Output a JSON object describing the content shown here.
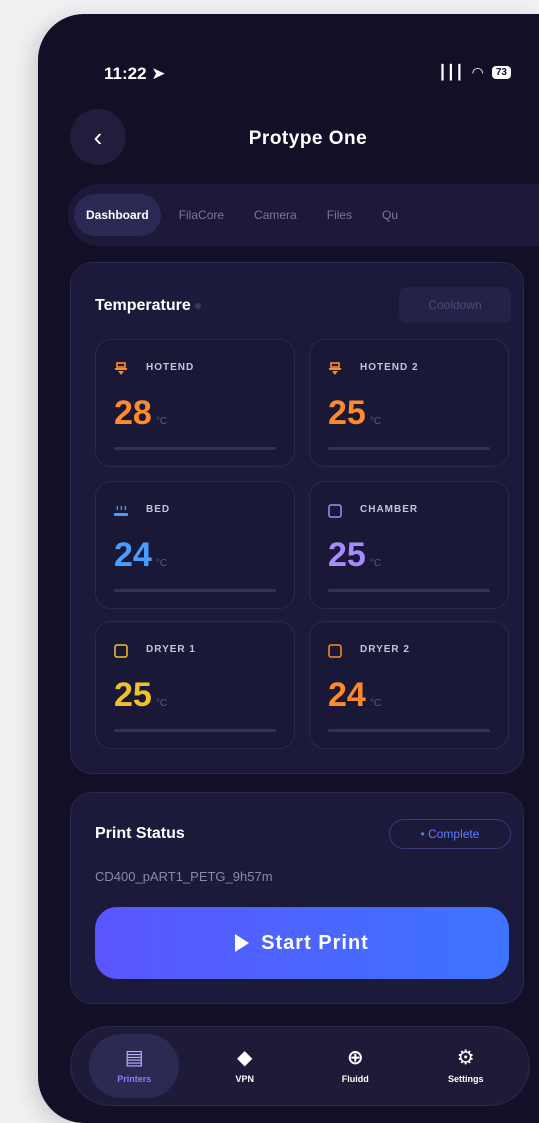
{
  "status_bar": {
    "time": "11:22",
    "signal": "│││",
    "battery": "73"
  },
  "header": {
    "title": "Protype One"
  },
  "tabs": [
    {
      "label": "Dashboard"
    },
    {
      "label": "FilaCore"
    },
    {
      "label": "Camera"
    },
    {
      "label": "Files"
    },
    {
      "label": "Qu"
    }
  ],
  "temperature": {
    "title": "Temperature",
    "cooldown_label": "Cooldown",
    "unit": "°C",
    "tiles": [
      {
        "label": "HOTEND",
        "value": "28",
        "color": "#ff8a2b",
        "icon": "hotend-icon"
      },
      {
        "label": "HOTEND 2",
        "value": "25",
        "color": "#ff8a2b",
        "icon": "hotend-icon"
      },
      {
        "label": "BED",
        "value": "24",
        "color": "#4a9dff",
        "icon": "bed-icon"
      },
      {
        "label": "CHAMBER",
        "value": "25",
        "color": "#a88bff",
        "icon": "chamber-icon"
      },
      {
        "label": "DRYER 1",
        "value": "25",
        "color": "#f1c12b",
        "icon": "dryer-icon"
      },
      {
        "label": "DRYER 2",
        "value": "24",
        "color": "#ff8a2b",
        "icon": "dryer-icon"
      }
    ]
  },
  "print_status": {
    "title": "Print Status",
    "status": "• Complete",
    "file_name": "CD400_pART1_PETG_9h57m",
    "start_label": "Start Print"
  },
  "nav": [
    {
      "label": "Printers",
      "icon": "printer-icon",
      "glyph": "▤"
    },
    {
      "label": "VPN",
      "icon": "shield-icon",
      "glyph": "◆"
    },
    {
      "label": "Fluidd",
      "icon": "globe-icon",
      "glyph": "⊕"
    },
    {
      "label": "Settings",
      "icon": "gear-icon",
      "glyph": "⚙"
    }
  ]
}
